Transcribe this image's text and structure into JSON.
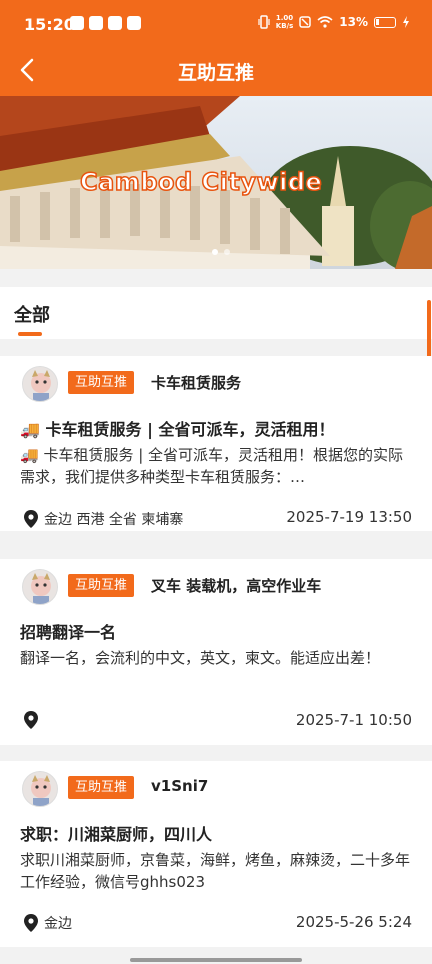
{
  "status_bar": {
    "time": "15:20",
    "net_speed_top": "1.00",
    "net_speed_bottom": "KB/s",
    "battery": "13%"
  },
  "header": {
    "title": "互助互推",
    "back_icon": "chevron-left-icon"
  },
  "banner": {
    "text": "Cambod Citywide",
    "page_index": 1,
    "page_count": 2
  },
  "tabs": [
    {
      "label": "全部",
      "active": true
    }
  ],
  "posts": [
    {
      "tag": "互助互推",
      "name": "卡车租赁服务",
      "headline": "🚚 卡车租赁服务 | 全省可派车，灵活租用！",
      "desc": "🚚 卡车租赁服务 | 全省可派车，灵活租用！根据您的实际需求，我们提供多种类型卡车租赁服务：…",
      "location": "金边 西港 全省 柬埔寨",
      "date": "2025-7-19 13:50"
    },
    {
      "tag": "互助互推",
      "name": "叉车 装载机，高空作业车",
      "headline": "招聘翻译一名",
      "desc": "翻译一名，会流利的中文，英文，柬文。能适应出差！",
      "location": "",
      "date": "2025-7-1 10:50"
    },
    {
      "tag": "互助互推",
      "name": "v1Sni7",
      "headline": "求职：川湘菜厨师，四川人",
      "desc": "求职川湘菜厨师，京鲁菜，海鲜，烤鱼，麻辣烫，二十多年工作经验，微信号ghhs023",
      "location": "金边",
      "date": "2025-5-26 5:24"
    }
  ],
  "colors": {
    "accent": "#f26a1b"
  }
}
